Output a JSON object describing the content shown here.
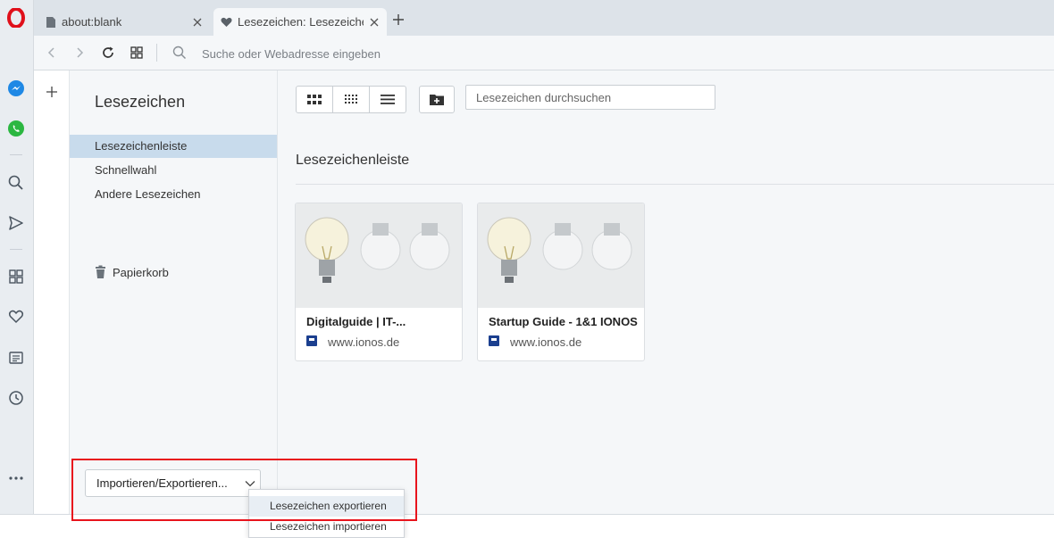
{
  "tabs": [
    {
      "title": "about:blank",
      "icon": "document-icon"
    },
    {
      "title": "Lesezeichen: Lesezeichenleiste",
      "icon": "heart-icon"
    }
  ],
  "address": {
    "placeholder": "Suche oder Webadresse eingeben"
  },
  "sidebar": {
    "title": "Lesezeichen",
    "items": [
      {
        "label": "Lesezeichenleiste",
        "selected": true
      },
      {
        "label": "Schnellwahl",
        "selected": false
      },
      {
        "label": "Andere Lesezeichen",
        "selected": false
      }
    ],
    "trash_label": "Papierkorb"
  },
  "toolbar": {
    "search_placeholder": "Lesezeichen durchsuchen",
    "views": [
      "large-grid-icon",
      "small-grid-icon",
      "list-icon"
    ]
  },
  "section_title": "Lesezeichenleiste",
  "bookmarks": [
    {
      "title": "Digitalguide | IT-...",
      "url": "www.ionos.de"
    },
    {
      "title": "Startup Guide - 1&1 IONOS",
      "url": "www.ionos.de"
    }
  ],
  "import_export": {
    "label": "Importieren/Exportieren...",
    "menu": [
      "Lesezeichen exportieren",
      "Lesezeichen importieren"
    ]
  },
  "colors": {
    "accent_selected": "#c8dbec",
    "highlight_box": "#e8141d",
    "opera_red": "#e0101b"
  }
}
